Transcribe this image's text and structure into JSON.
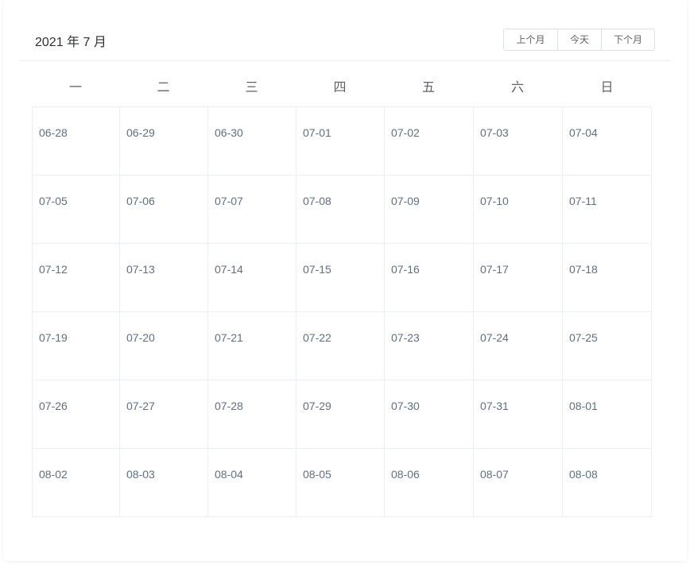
{
  "header": {
    "title": "2021 年 7 月",
    "prev_label": "上个月",
    "today_label": "今天",
    "next_label": "下个月"
  },
  "weekdays": [
    "一",
    "二",
    "三",
    "四",
    "五",
    "六",
    "日"
  ],
  "weeks": [
    [
      "06-28",
      "06-29",
      "06-30",
      "07-01",
      "07-02",
      "07-03",
      "07-04"
    ],
    [
      "07-05",
      "07-06",
      "07-07",
      "07-08",
      "07-09",
      "07-10",
      "07-11"
    ],
    [
      "07-12",
      "07-13",
      "07-14",
      "07-15",
      "07-16",
      "07-17",
      "07-18"
    ],
    [
      "07-19",
      "07-20",
      "07-21",
      "07-22",
      "07-23",
      "07-24",
      "07-25"
    ],
    [
      "07-26",
      "07-27",
      "07-28",
      "07-29",
      "07-30",
      "07-31",
      "08-01"
    ],
    [
      "08-02",
      "08-03",
      "08-04",
      "08-05",
      "08-06",
      "08-07",
      "08-08"
    ]
  ],
  "colors": {
    "date_text": "#606f82",
    "border": "#ebeef5"
  }
}
